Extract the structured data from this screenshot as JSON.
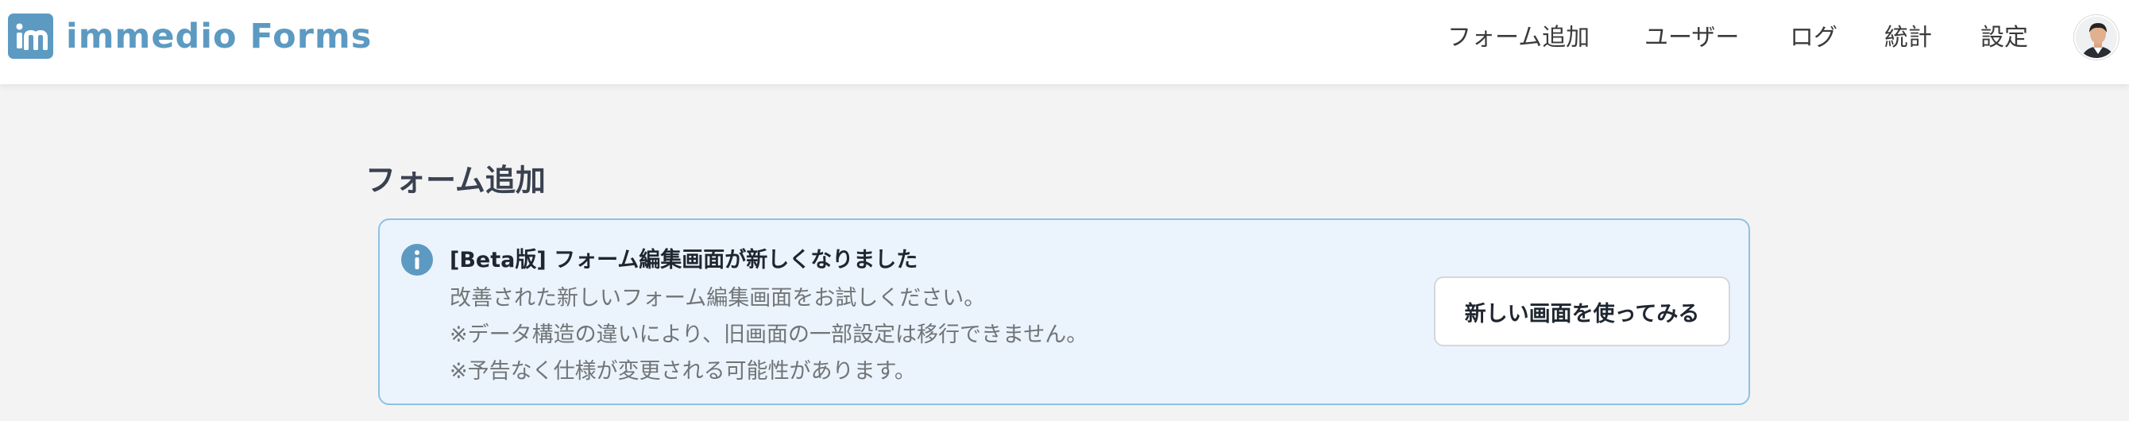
{
  "app": {
    "logo_mark": "im",
    "logo_text": "immedio Forms",
    "brand_color": "#5d9ac2"
  },
  "nav": {
    "items": [
      {
        "label": "フォーム追加"
      },
      {
        "label": "ユーザー"
      },
      {
        "label": "ログ"
      },
      {
        "label": "統計"
      },
      {
        "label": "設定"
      }
    ],
    "avatar_icon": "user-avatar"
  },
  "page": {
    "title": "フォーム追加"
  },
  "alert": {
    "icon": "info-icon",
    "title": "[Beta版] フォーム編集画面が新しくなりました",
    "lines": [
      "改善された新しいフォーム編集画面をお試しください。",
      "※データ構造の違いにより、旧画面の一部設定は移行できません。",
      "※予告なく仕様が変更される可能性があります。"
    ],
    "button_label": "新しい画面を使ってみる",
    "accent_color": "#8ec2e2",
    "background_color": "#ebf4fc"
  }
}
